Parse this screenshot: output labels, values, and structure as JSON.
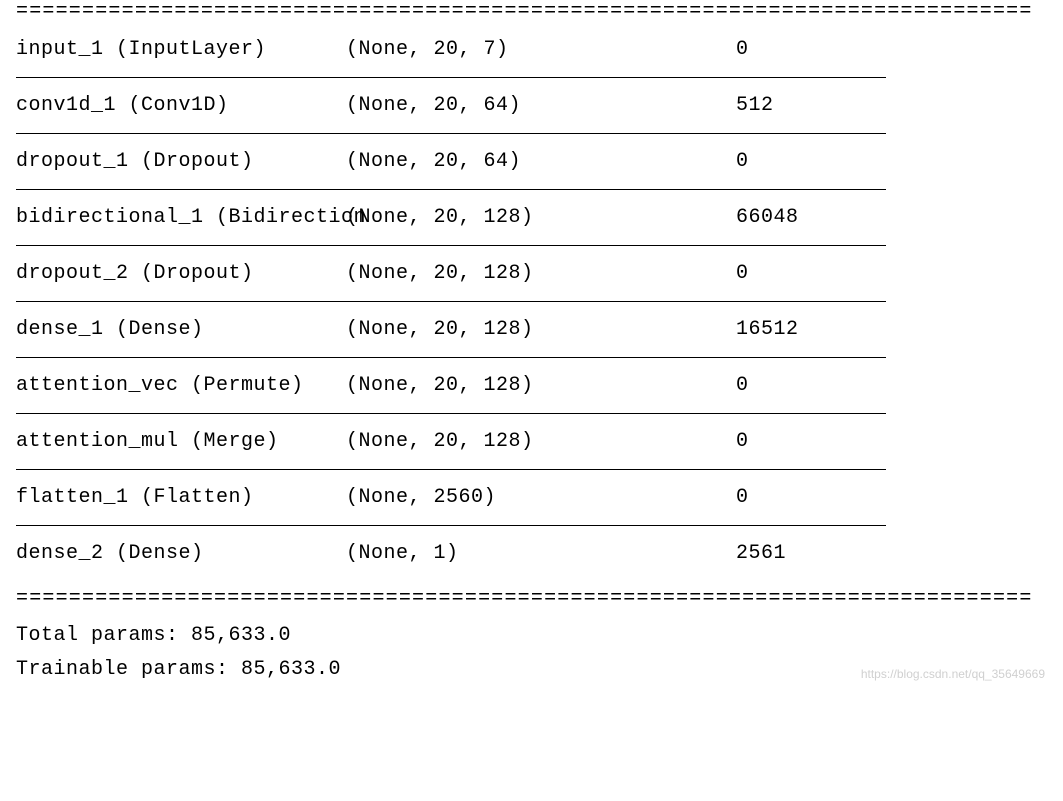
{
  "header_line": "=============================================================================",
  "layers": [
    {
      "name": "input_1 (InputLayer)",
      "shape": "(None, 20, 7)",
      "params": "0"
    },
    {
      "name": "conv1d_1 (Conv1D)",
      "shape": "(None, 20, 64)",
      "params": "512"
    },
    {
      "name": "dropout_1 (Dropout)",
      "shape": "(None, 20, 64)",
      "params": "0"
    },
    {
      "name": "bidirectional_1 (Bidirection",
      "shape": "(None, 20, 128)",
      "params": "66048"
    },
    {
      "name": "dropout_2 (Dropout)",
      "shape": "(None, 20, 128)",
      "params": "0"
    },
    {
      "name": "dense_1 (Dense)",
      "shape": "(None, 20, 128)",
      "params": "16512"
    },
    {
      "name": "attention_vec (Permute)",
      "shape": "(None, 20, 128)",
      "params": "0"
    },
    {
      "name": "attention_mul (Merge)",
      "shape": "(None, 20, 128)",
      "params": "0"
    },
    {
      "name": "flatten_1 (Flatten)",
      "shape": "(None, 2560)",
      "params": "0"
    },
    {
      "name": "dense_2 (Dense)",
      "shape": "(None, 1)",
      "params": "2561"
    }
  ],
  "footer_line": "=============================================================================",
  "summary": {
    "total": "Total params: 85,633.0",
    "trainable": "Trainable params: 85,633.0"
  },
  "watermark": "https://blog.csdn.net/qq_35649669"
}
